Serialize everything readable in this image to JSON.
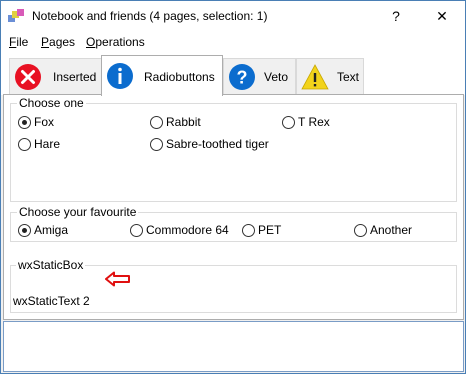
{
  "window": {
    "title": "Notebook and friends (4 pages, selection: 1)",
    "help_glyph": "?",
    "close_glyph": "✕"
  },
  "menu": {
    "items": [
      {
        "label": "File"
      },
      {
        "label": "Pages"
      },
      {
        "label": "Operations"
      }
    ]
  },
  "tabs": [
    {
      "label": "Inserted",
      "icon": "error-icon",
      "color": "#e81123"
    },
    {
      "label": "Radiobuttons",
      "icon": "info-icon",
      "color": "#0b6cce",
      "active": true
    },
    {
      "label": "Veto",
      "icon": "question-icon",
      "color": "#0b6cce"
    },
    {
      "label": "Text",
      "icon": "warning-icon",
      "color": "#f2d31b"
    }
  ],
  "groups": {
    "choose_one": {
      "title": "Choose one",
      "options": [
        "Fox",
        "Rabbit",
        "T Rex",
        "Hare",
        "Sabre-toothed tiger"
      ],
      "selected": "Fox"
    },
    "favourite": {
      "title": "Choose your favourite",
      "options": [
        "Amiga",
        "Commodore 64",
        "PET",
        "Another"
      ],
      "selected": "Amiga"
    },
    "static_box": {
      "title": "wxStaticBox",
      "text": "wxStaticText 2",
      "arrow_color": "#e01010"
    }
  }
}
